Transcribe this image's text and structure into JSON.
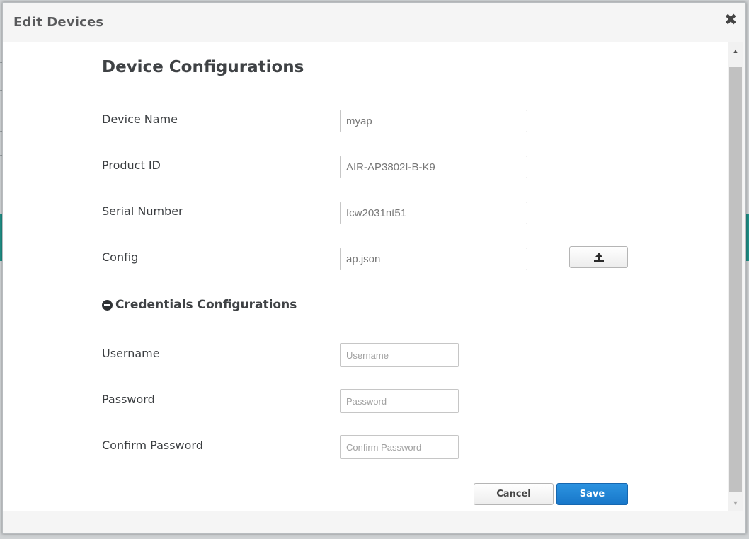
{
  "modal": {
    "title": "Edit Devices",
    "close_icon": "close-icon"
  },
  "device_config": {
    "heading": "Device Configurations",
    "fields": [
      {
        "label": "Device Name",
        "value": "myap"
      },
      {
        "label": "Product ID",
        "value": "AIR-AP3802I-B-K9"
      },
      {
        "label": "Serial Number",
        "value": "fcw2031nt51"
      },
      {
        "label": "Config",
        "value": "ap.json"
      }
    ],
    "upload_icon": "upload-icon"
  },
  "credentials": {
    "heading": "Credentials Configurations",
    "toggle_icon": "minus-circle-icon",
    "fields": [
      {
        "label": "Username",
        "placeholder": "Username",
        "value": ""
      },
      {
        "label": "Password",
        "placeholder": "Password",
        "value": ""
      },
      {
        "label": "Confirm Password",
        "placeholder": "Confirm Password",
        "value": ""
      }
    ]
  },
  "buttons": {
    "cancel_label": "Cancel",
    "save_label": "Save"
  },
  "colors": {
    "primary": "#1877c9",
    "background_accent": "#1f8f86"
  }
}
